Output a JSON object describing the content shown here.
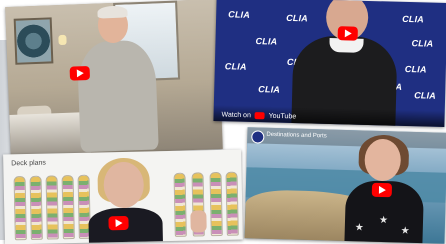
{
  "collage": {
    "tiles": [
      {
        "id": "stateroom-video",
        "play_icon": "play-icon"
      },
      {
        "id": "clia-logo-video",
        "logo_text": "CLIA",
        "watch_on_label": "Watch on",
        "platform_label": "YouTube",
        "play_icon": "play-icon"
      },
      {
        "id": "deck-plans-video",
        "deck_title": "Deck plans",
        "play_icon": "play-icon"
      },
      {
        "id": "destinations-video",
        "video_title": "Destinations and Ports",
        "play_icon": "play-icon"
      }
    ]
  },
  "colors": {
    "youtube_red": "#ff0000",
    "clia_blue": "#1f2f82"
  }
}
